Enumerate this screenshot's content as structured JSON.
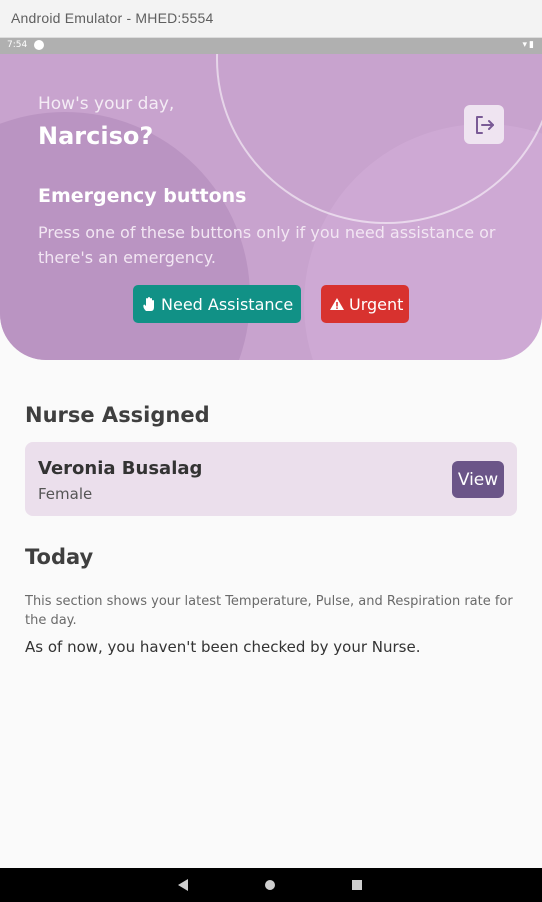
{
  "window": {
    "title": "Android Emulator - MHED:5554"
  },
  "status_bar": {
    "time": "7:54"
  },
  "header": {
    "greeting": "How's your day,",
    "user_name": "Narciso?",
    "emergency_title": "Emergency buttons",
    "emergency_desc": "Press one of these buttons only if you need assistance or there's an emergency.",
    "assist_label": "Need Assistance",
    "urgent_label": "Urgent",
    "colors": {
      "header_bg": "#c8a3ce",
      "assist": "#119186",
      "urgent": "#d8322f"
    }
  },
  "nurse": {
    "section_title": "Nurse Assigned",
    "name": "Veronia Busalag",
    "gender": "Female",
    "view_label": "View"
  },
  "today": {
    "section_title": "Today",
    "description": "This section shows your latest Temperature, Pulse, and Respiration rate for the day.",
    "message": "As of now, you haven't been checked by your Nurse."
  },
  "icons": [
    "logout-icon",
    "hand-icon",
    "warning-icon",
    "wifi-icon",
    "battery-icon",
    "back-icon",
    "home-icon",
    "recents-icon"
  ]
}
